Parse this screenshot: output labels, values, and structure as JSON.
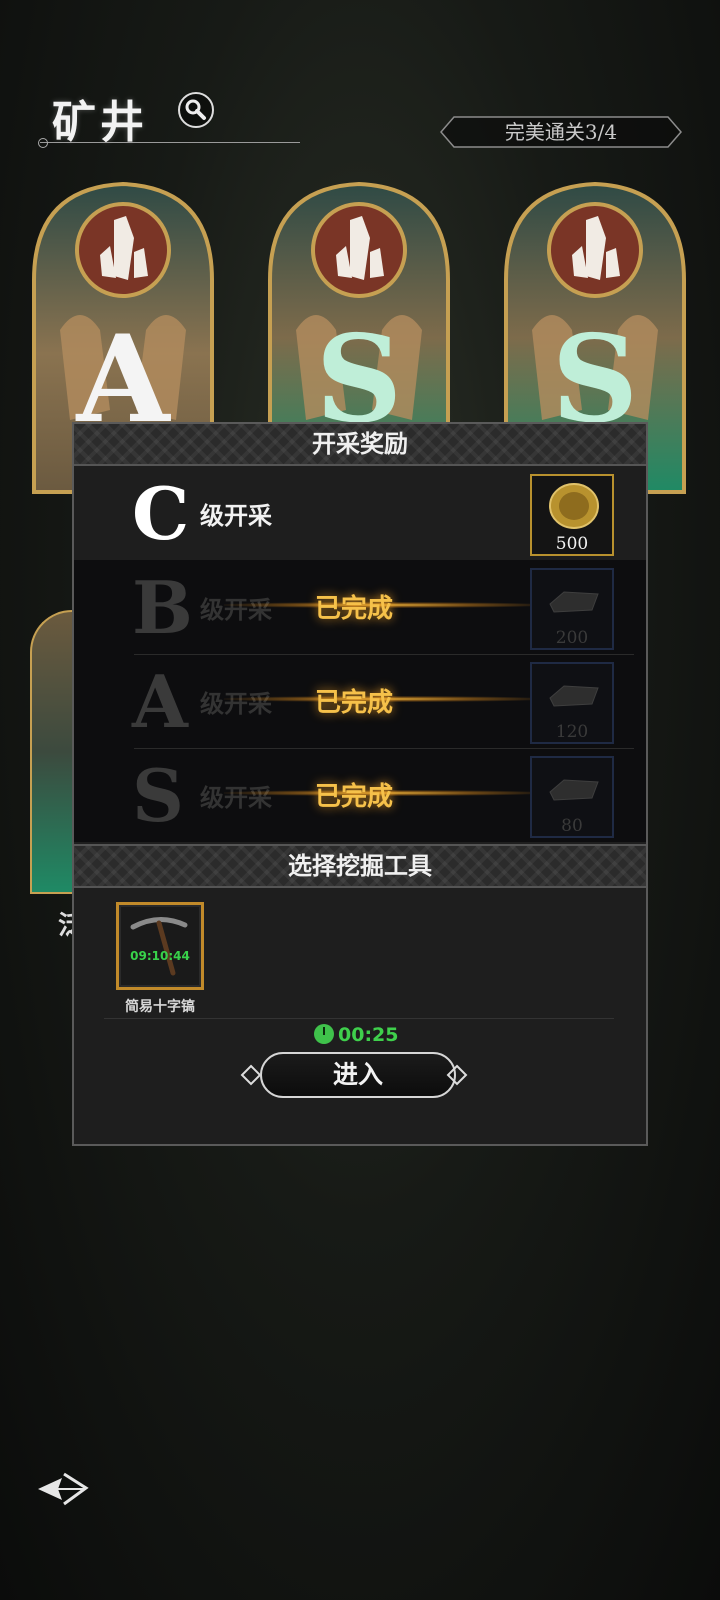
{
  "header": {
    "title": "矿井",
    "search_icon": "search-icon"
  },
  "progress_badge": {
    "text": "完美通关3/4"
  },
  "mine_cards": [
    {
      "grade": "A"
    },
    {
      "grade": "S"
    },
    {
      "grade": "S"
    }
  ],
  "lower_card": {
    "label": "泛"
  },
  "panel": {
    "reward_header": "开采奖励",
    "rewards": [
      {
        "grade": "C",
        "suffix": "级开采",
        "count": "500",
        "status": "",
        "item_icon": "gold-coin-icon"
      },
      {
        "grade": "B",
        "suffix": "级开采",
        "count": "200",
        "status": "已完成",
        "item_icon": "ingot-icon"
      },
      {
        "grade": "A",
        "suffix": "级开采",
        "count": "120",
        "status": "已完成",
        "item_icon": "ingot-icon"
      },
      {
        "grade": "S",
        "suffix": "级开采",
        "count": "80",
        "status": "已完成",
        "item_icon": "ingot-icon"
      }
    ],
    "tool_header": "选择挖掘工具",
    "tool": {
      "name": "简易十字镐",
      "timer": "09:10:44",
      "icon": "pickaxe-icon"
    },
    "countdown": "00:25",
    "enter_label": "进入"
  },
  "colors": {
    "gold": "#c18a2a",
    "done": "#f6c14a",
    "green": "#3fd04c",
    "teal": "#1f8a65"
  }
}
